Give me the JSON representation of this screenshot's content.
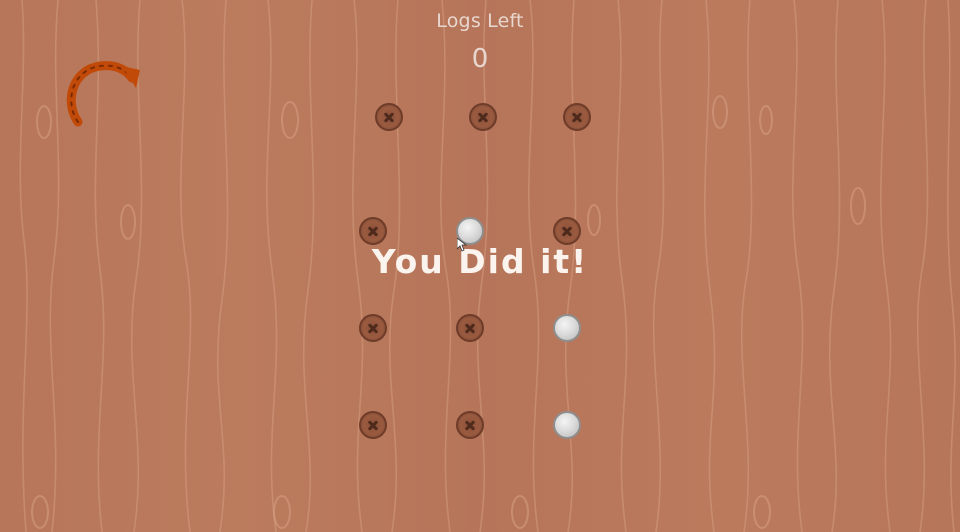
{
  "hud": {
    "label": "Logs Left",
    "count": "0"
  },
  "message": "You Did it!",
  "icons": {
    "restart": "restart-arrow-icon",
    "cursor": "mouse-pointer-icon"
  },
  "board": {
    "rows": [
      [
        "empty",
        "empty",
        "empty"
      ],
      [
        "empty",
        "filled",
        "empty"
      ],
      [
        "empty",
        "empty",
        "filled"
      ],
      [
        "empty",
        "empty",
        "filled"
      ]
    ]
  },
  "colors": {
    "wood": "#b9785a",
    "grain": "#d9a487",
    "hud_text": "#e8d7cf",
    "restart_arrow": "#c24a08"
  }
}
